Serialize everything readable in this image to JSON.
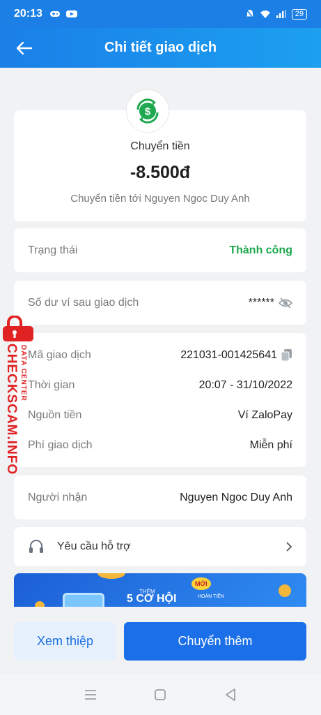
{
  "status_bar": {
    "time": "20:13",
    "battery": "29"
  },
  "header": {
    "title": "Chi tiết giao dịch"
  },
  "transaction": {
    "type": "Chuyển tiền",
    "amount": "-8.500đ",
    "description": "Chuyển tiền tới Nguyen Ngoc Duy Anh"
  },
  "status": {
    "label": "Trạng thái",
    "value": "Thành công",
    "color": "#1ea84f"
  },
  "balance": {
    "label": "Số dư ví sau giao dịch",
    "value": "******"
  },
  "details": {
    "code_label": "Mã giao dịch",
    "code_value": "221031-001425641",
    "time_label": "Thời gian",
    "time_value": "20:07 - 31/10/2022",
    "source_label": "Nguồn tiền",
    "source_value": "Ví ZaloPay",
    "fee_label": "Phí giao dịch",
    "fee_value": "Miễn phí"
  },
  "recipient": {
    "label": "Người nhận",
    "value": "Nguyen Ngoc Duy Anh"
  },
  "support": {
    "label": "Yêu cầu hỗ trợ"
  },
  "banner": {
    "small": "THÊM",
    "big": "5 CƠ HỘI",
    "tag": "MỚI",
    "sub": "HOÀN TIỀN"
  },
  "actions": {
    "secondary": "Xem thiệp",
    "primary": "Chuyển thêm"
  },
  "watermark": {
    "main": "CHECKSCAM.INFO",
    "sub": "DATA CENTER"
  },
  "colors": {
    "primary": "#1b6fe8",
    "success": "#1ea84f",
    "watermark": "#e02222"
  }
}
